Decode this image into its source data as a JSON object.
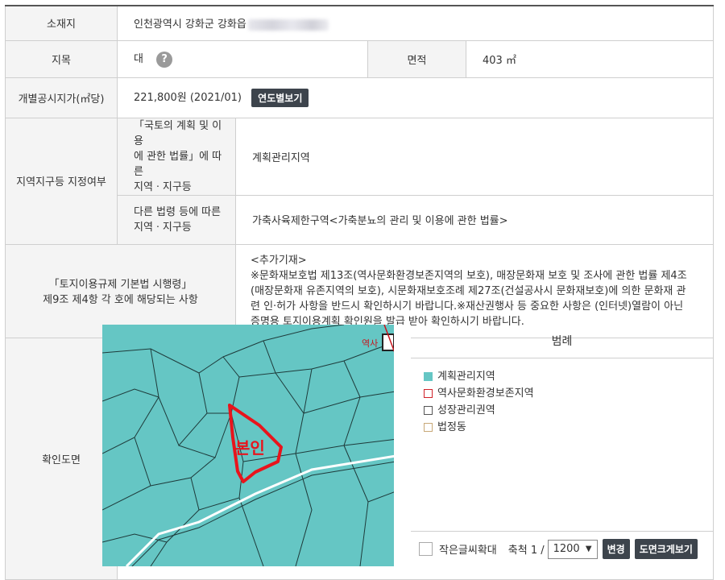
{
  "location": {
    "label": "소재지",
    "value": "인천광역시 강화군 강화읍"
  },
  "land_category": {
    "label": "지목",
    "value": "대",
    "help_icon": "?"
  },
  "area": {
    "label": "면적",
    "value": "403 ㎡"
  },
  "official_price": {
    "label": "개별공시지가(㎡당)",
    "value": "221,800원 (2021/01)",
    "button": "연도별보기"
  },
  "zoning": {
    "label": "지역지구등 지정여부",
    "rows": [
      {
        "sub_label_lines": [
          "「국토의 계획 및 이용",
          "에 관한 법률」에 따른",
          "지역ㆍ지구등"
        ],
        "value": "계획관리지역"
      },
      {
        "sub_label_lines": [
          "다른 법령 등에 따른",
          "지역ㆍ지구등"
        ],
        "value": "가축사육제한구역<가축분뇨의 관리 및 이용에 관한 법률>"
      }
    ]
  },
  "enforcement": {
    "label_lines": [
      "「토지이용규제 기본법 시행령」",
      "제9조 제4항 각 호에 해당되는 사항"
    ],
    "note_lines": [
      "<추가기재>",
      "※문화재보호법 제13조(역사문화환경보존지역의 보호), 매장문화재 보호 및 조사에 관한 법률 제4조",
      "(매장문화재 유존지역의 보호), 시문화재보호조례 제27조(건설공사시 문화재보호)에 의한 문화재 관",
      "련 인·허가 사항을 반드시 확인하시기 바랍니다.※재산권행사 등 중요한 사항은 (인터넷)열람이 아닌",
      "증명용 토지이용계획 확인원을 발급 받아 확인하시기 바랍니다."
    ]
  },
  "map": {
    "label": "확인도면",
    "parcel_label": "본인",
    "corner_text": "역사",
    "colors": {
      "plan_area": "#65c6c4",
      "parcel_outline": "#e8141c"
    }
  },
  "legend": {
    "title": "범례",
    "items": [
      {
        "label": "계획관리지역",
        "swatch": "#65c6c4",
        "style": "fill"
      },
      {
        "label": "역사문화환경보존지역",
        "swatch": "#d0222a",
        "style": "outline"
      },
      {
        "label": "성장관리권역",
        "swatch": "#555555",
        "style": "outline"
      },
      {
        "label": "법정동",
        "swatch": "#c8a878",
        "style": "outline"
      }
    ]
  },
  "controls": {
    "small_text_zoom": "작은글씨확대",
    "scale_label": "축척 1 /",
    "scale_value": "1200",
    "change_button": "변경",
    "large_map_button": "도면크게보기"
  }
}
